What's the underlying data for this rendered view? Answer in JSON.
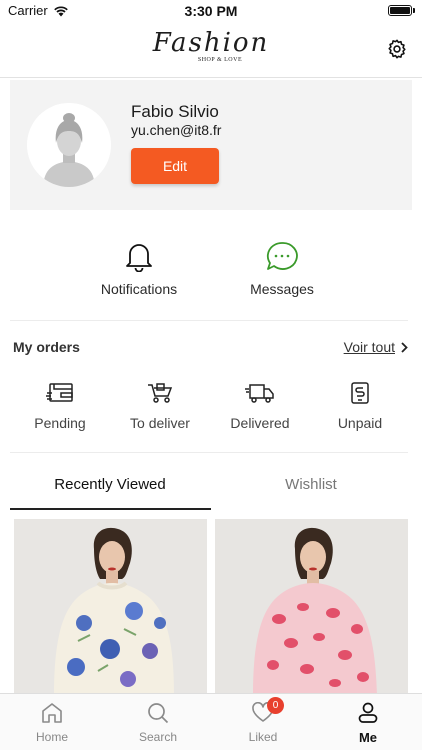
{
  "status_bar": {
    "carrier": "Carrier",
    "time": "3:30 PM"
  },
  "nav": {
    "logo_main": "Fashion",
    "logo_sub": "SHOP & LOVE",
    "settings_icon": "gear-icon"
  },
  "profile": {
    "name": "Fabio Silvio",
    "email": "yu.chen@it8.fr",
    "edit_label": "Edit"
  },
  "shortcuts": [
    {
      "label": "Notifications",
      "icon": "bell-icon"
    },
    {
      "label": "Messages",
      "icon": "chat-bubble-icon"
    }
  ],
  "orders": {
    "title": "My orders",
    "see_all": "Voir tout",
    "items": [
      {
        "label": "Pending",
        "icon": "wallet-icon"
      },
      {
        "label": "To deliver",
        "icon": "cart-icon"
      },
      {
        "label": "Delivered",
        "icon": "truck-icon"
      },
      {
        "label": "Unpaid",
        "icon": "phone-payment-icon"
      }
    ]
  },
  "tabs": [
    {
      "label": "Recently Viewed",
      "active": true
    },
    {
      "label": "Wishlist",
      "active": false
    }
  ],
  "products": [
    {
      "image": "woman-cream-floral-sweater"
    },
    {
      "image": "woman-pink-leopard-sweater"
    }
  ],
  "tab_bar": [
    {
      "label": "Home",
      "icon": "home-icon",
      "active": false
    },
    {
      "label": "Search",
      "icon": "search-icon",
      "active": false
    },
    {
      "label": "Liked",
      "icon": "heart-icon",
      "active": false,
      "badge": "0"
    },
    {
      "label": "Me",
      "icon": "person-icon",
      "active": true
    }
  ],
  "colors": {
    "accent": "#f45a22",
    "messages_green": "#3a9a2a",
    "badge_red": "#e8402e"
  }
}
